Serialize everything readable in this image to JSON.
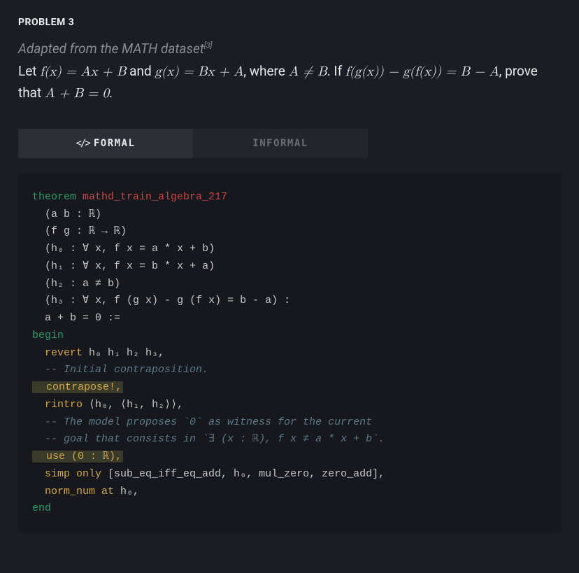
{
  "title": "PROBLEM 3",
  "adapted_prefix": "Adapted from the MATH dataset",
  "adapted_ref": "[3]",
  "problem_html": "Let <span class=\"math\">f(x) = Ax + B</span> and <span class=\"math\">g(x) = Bx + A</span>, where <span class=\"math\">A ≠ B</span>. If <span class=\"math\">f(g(x)) − g(f(x)) = B − A</span>, prove that <span class=\"math\">A + B = 0</span>.",
  "tabs": {
    "formal_icon": "</>",
    "formal": "FORMAL",
    "informal": "INFORMAL"
  },
  "code": {
    "l1_kw": "theorem",
    "l1_name": " mathd_train_algebra_217",
    "l2": "  (a b : ℝ)",
    "l3": "  (f g : ℝ → ℝ)",
    "l4": "  (h₀ : ∀ x, f x = a * x + b)",
    "l5": "  (h₁ : ∀ x, f x = b * x + a)",
    "l6": "  (h₂ : a ≠ b)",
    "l7": "  (h₃ : ∀ x, f (g x) - g (f x) = b - a) :",
    "l8": "  a + b = 0 :=",
    "l9_kw": "begin",
    "l10_t": "  revert",
    "l10_r": " h₀ h₁ h₂ h₃,",
    "l11_c": "  -- Initial contraposition.",
    "l12_hl": "  contrapose!,",
    "l13_t": "  rintro",
    "l13_r": " ⟨h₀, ⟨h₁, h₂⟩⟩,",
    "l14_c": "  -- The model proposes `0` as witness for the current",
    "l15_c": "  -- goal that consists in `∃ (x : ℝ), f x ≠ a * x + b`.",
    "l16_hl": "  use (0 : ℝ),",
    "l17_t": "  simp only",
    "l17_r": " [sub_eq_iff_eq_add, h₀, mul_zero, zero_add],",
    "l18_t": "  norm_num at",
    "l18_r": " h₀,",
    "l19_kw": "end"
  }
}
